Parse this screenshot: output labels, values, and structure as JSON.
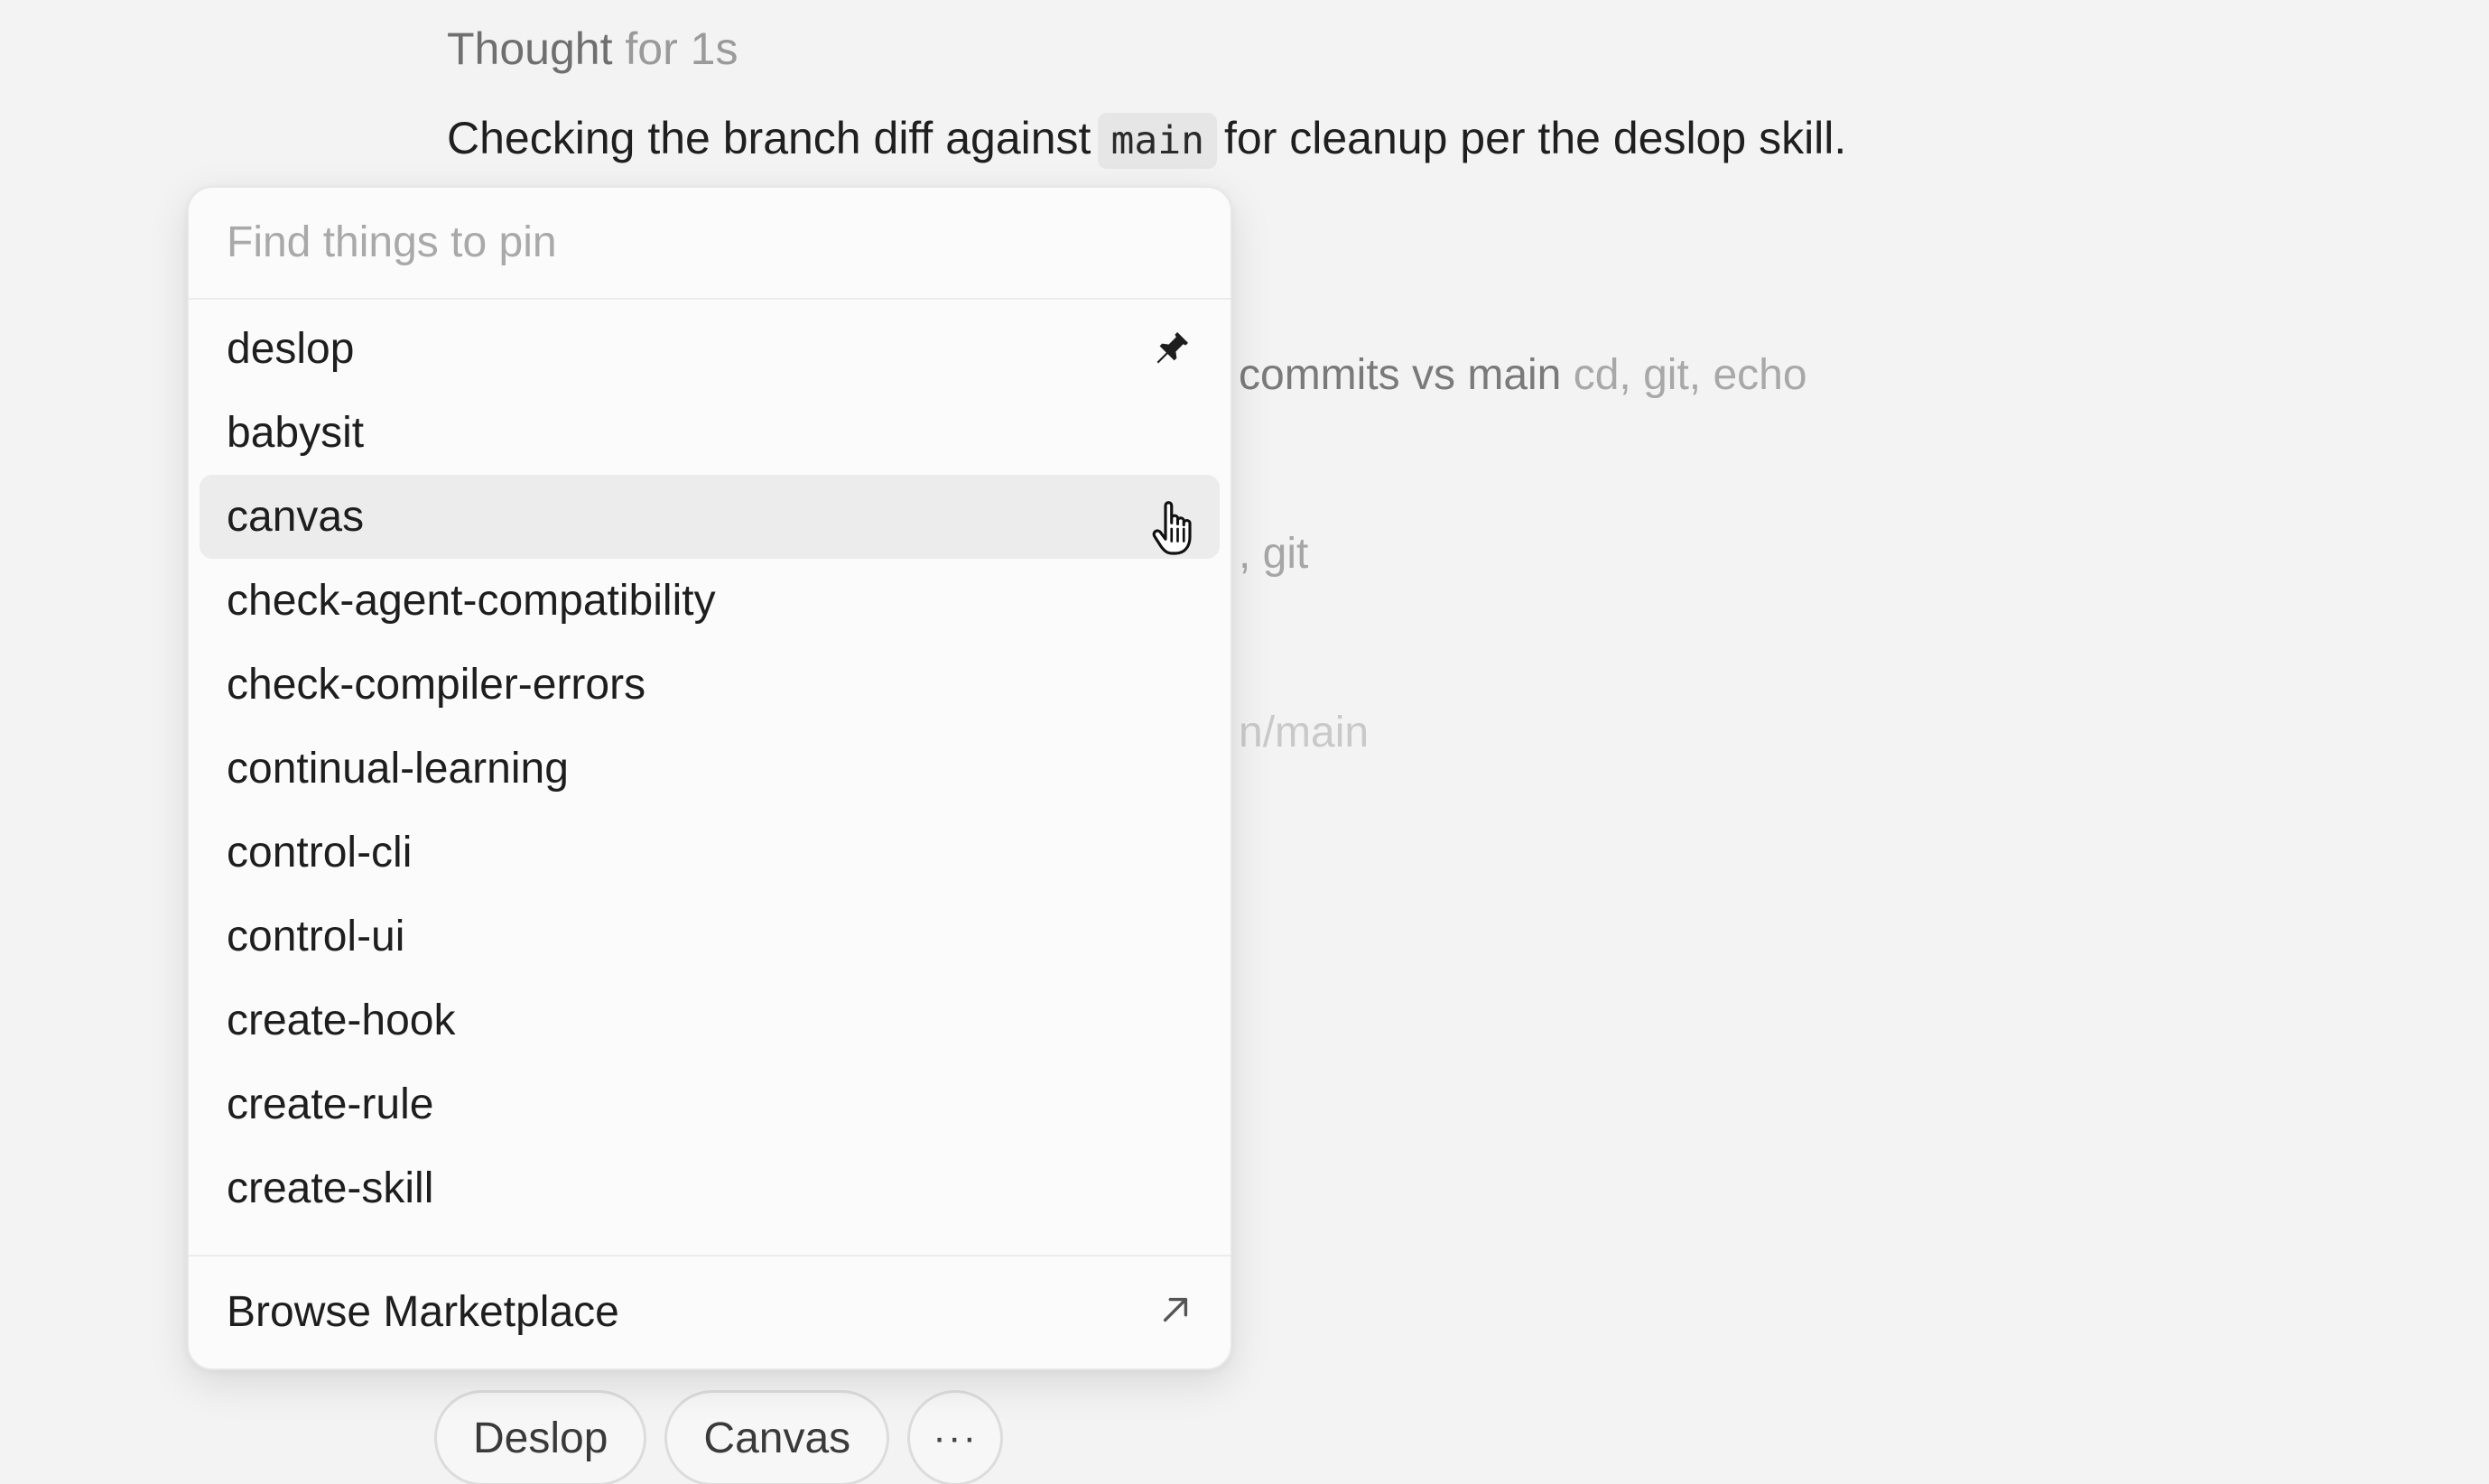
{
  "chat": {
    "thought_label": "Thought",
    "thought_duration": "for 1s",
    "message_before": "Checking the branch diff against",
    "message_code": "main",
    "message_after": "for cleanup per the deslop skill.",
    "tool_line_1_main": "commits vs main",
    "tool_line_1_cmds": "cd, git, echo",
    "tool_line_2": ", git",
    "tool_line_3": "n/main"
  },
  "pin_menu": {
    "search_placeholder": "Find things to pin",
    "search_value": "",
    "items": [
      {
        "label": "deslop",
        "pinned": true
      },
      {
        "label": "babysit"
      },
      {
        "label": "canvas",
        "hovered": true
      },
      {
        "label": "check-agent-compatibility"
      },
      {
        "label": "check-compiler-errors"
      },
      {
        "label": "continual-learning"
      },
      {
        "label": "control-cli"
      },
      {
        "label": "control-ui"
      },
      {
        "label": "create-hook"
      },
      {
        "label": "create-rule"
      },
      {
        "label": "create-skill"
      }
    ],
    "footer_label": "Browse Marketplace",
    "footer_icon": "external-arrow-icon",
    "pin_icon": "pin-icon"
  },
  "chips": {
    "deslop": "Deslop",
    "canvas": "Canvas",
    "more": "···"
  }
}
